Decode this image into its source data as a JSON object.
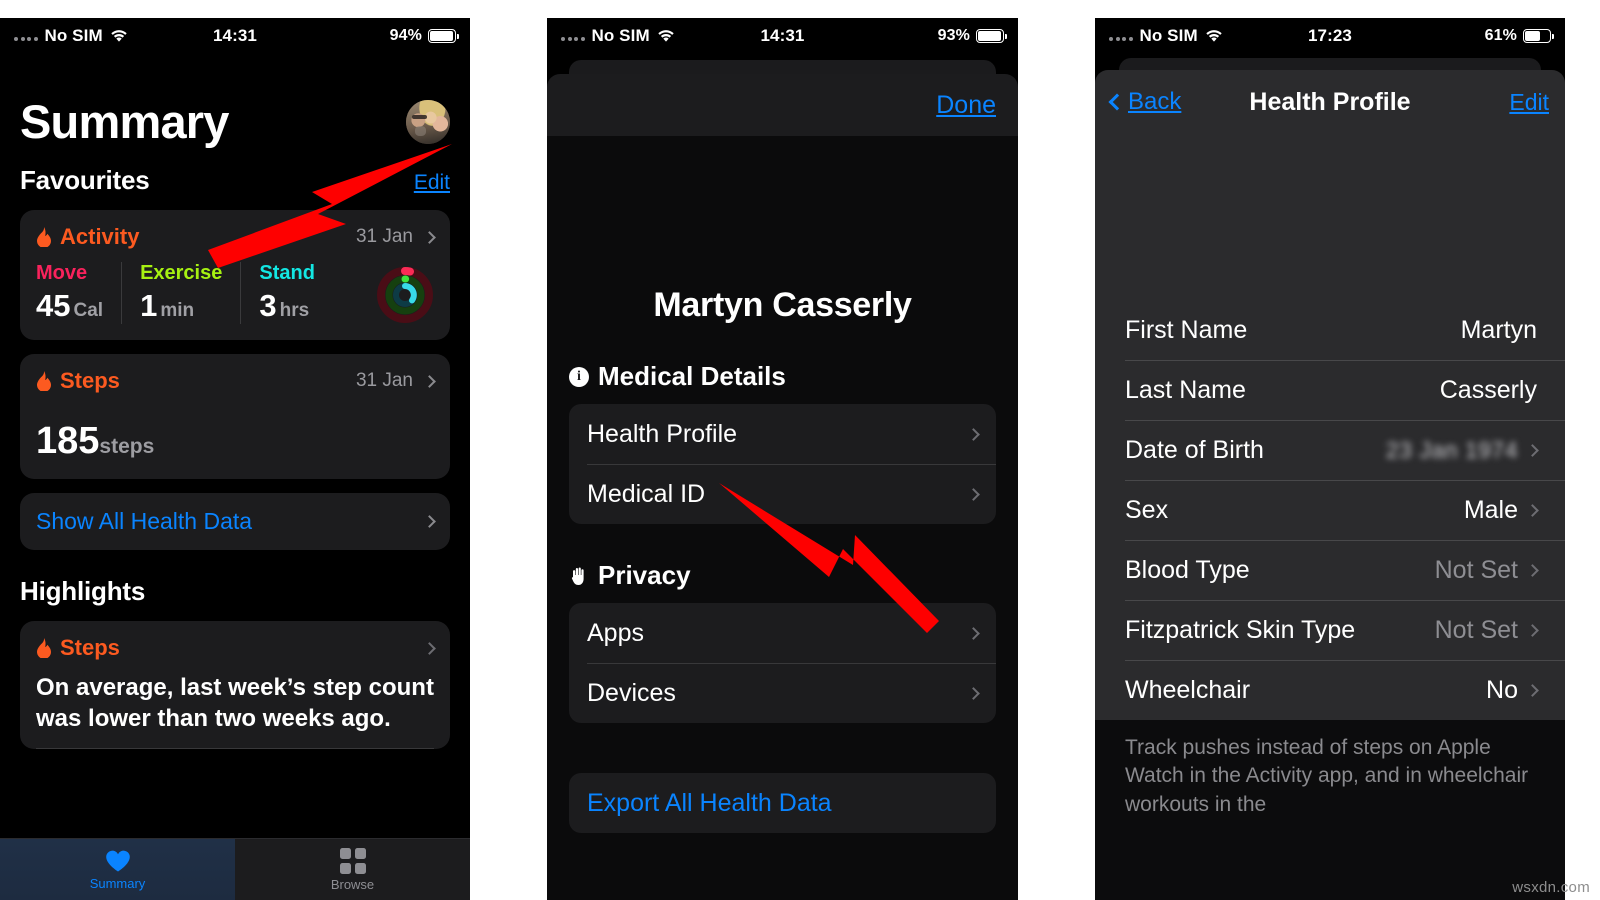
{
  "watermark": "wsxdn.com",
  "panel1": {
    "status": {
      "carrier": "No SIM",
      "time": "14:31",
      "battery": "94%"
    },
    "page_title": "Summary",
    "avatar_name": "avatar",
    "favourites": {
      "heading": "Favourites",
      "edit_label": "Edit"
    },
    "activity_card": {
      "title": "Activity",
      "date": "31 Jan",
      "metrics": [
        {
          "label": "Move",
          "value": "45",
          "unit": "Cal"
        },
        {
          "label": "Exercise",
          "value": "1",
          "unit": "min"
        },
        {
          "label": "Stand",
          "value": "3",
          "unit": "hrs"
        }
      ]
    },
    "steps_card": {
      "title": "Steps",
      "date": "31 Jan",
      "value": "185",
      "unit": "steps"
    },
    "show_all_link": "Show All Health Data",
    "highlights": {
      "heading": "Highlights",
      "card_title": "Steps",
      "card_text": "On average, last week’s step count was lower than two weeks ago."
    },
    "tabs": [
      {
        "label": "Summary",
        "icon": "heart-icon",
        "active": true
      },
      {
        "label": "Browse",
        "icon": "grid-icon",
        "active": false
      }
    ]
  },
  "panel2": {
    "status": {
      "carrier": "No SIM",
      "time": "14:31",
      "battery": "93%"
    },
    "done_label": "Done",
    "profile_name": "Martyn Casserly",
    "groups": [
      {
        "heading": "Medical Details",
        "icon": "info-icon",
        "rows": [
          {
            "label": "Health Profile",
            "style": "normal"
          },
          {
            "label": "Medical ID",
            "style": "normal"
          }
        ]
      },
      {
        "heading": "Privacy",
        "icon": "hand-icon",
        "rows": [
          {
            "label": "Apps",
            "style": "normal"
          },
          {
            "label": "Devices",
            "style": "normal"
          }
        ]
      }
    ],
    "export_label": "Export All Health Data"
  },
  "panel3": {
    "status": {
      "carrier": "No SIM",
      "time": "17:23",
      "battery": "61%"
    },
    "nav": {
      "back_label": "Back",
      "title": "Health Profile",
      "edit_label": "Edit"
    },
    "rows": [
      {
        "label": "First Name",
        "value": "Martyn",
        "style": "value",
        "chevron": false
      },
      {
        "label": "Last Name",
        "value": "Casserly",
        "style": "value",
        "chevron": false
      },
      {
        "label": "Date of Birth",
        "value": "23 Jan 1974",
        "style": "blurred",
        "chevron": true
      },
      {
        "label": "Sex",
        "value": "Male",
        "style": "value",
        "chevron": true
      },
      {
        "label": "Blood Type",
        "value": "Not Set",
        "style": "notset",
        "chevron": true
      },
      {
        "label": "Fitzpatrick Skin Type",
        "value": "Not Set",
        "style": "notset",
        "chevron": true
      },
      {
        "label": "Wheelchair",
        "value": "No",
        "style": "value",
        "chevron": true
      }
    ],
    "footer": "Track pushes instead of steps on Apple Watch in the Activity app, and in wheelchair workouts in the"
  }
}
